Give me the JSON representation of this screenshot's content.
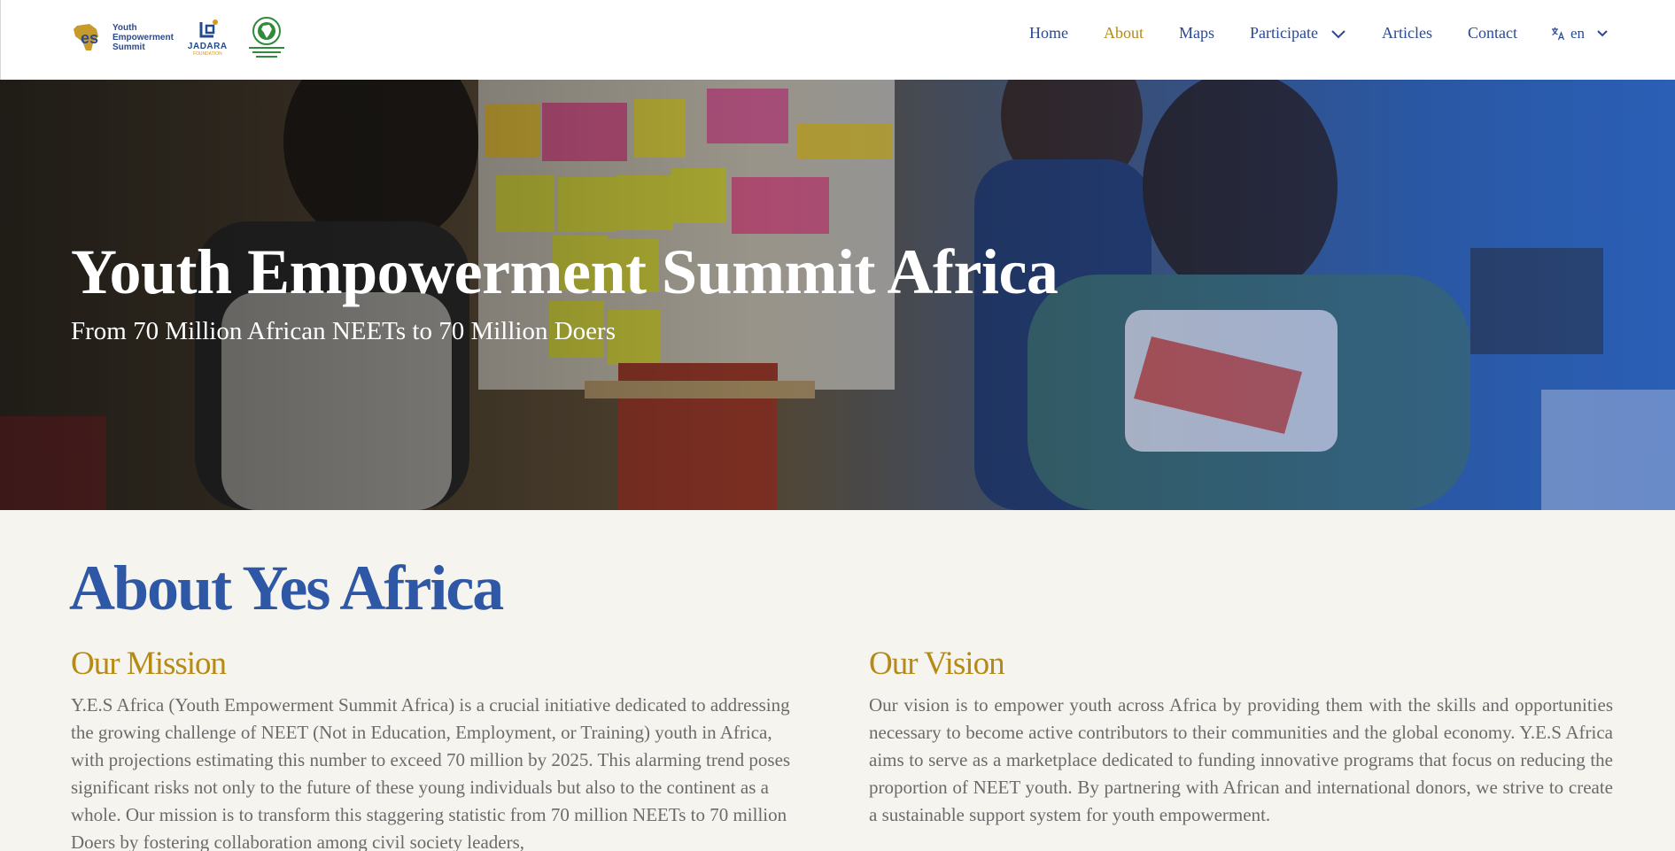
{
  "header": {
    "logos": {
      "yes": {
        "mark": "Yes",
        "line1": "Youth",
        "line2": "Empowerment",
        "line3": "Summit"
      },
      "jadara": {
        "name": "JADARA",
        "tagline": "FOUNDATION"
      },
      "au": {
        "icon": "african-union-emblem"
      }
    },
    "nav": {
      "home": "Home",
      "about": "About",
      "maps": "Maps",
      "participate": "Participate",
      "articles": "Articles",
      "contact": "Contact",
      "language": "en"
    },
    "active_item": "About",
    "colors": {
      "nav": "#2a4a8f",
      "active": "#b58a16"
    }
  },
  "hero": {
    "title": "Youth Empowerment Summit Africa",
    "subtitle": "From 70 Million African NEETs to 70 Million Doers"
  },
  "about": {
    "title": "About Yes Africa",
    "mission": {
      "heading": "Our Mission",
      "text": "Y.E.S Africa (Youth Empowerment Summit Africa) is a crucial initiative dedicated to addressing the growing challenge of NEET (Not in Education, Employment, or Training) youth in Africa, with projections estimating this number to exceed 70 million by 2025. This alarming trend poses significant risks not only to the future of these young individuals but also to the continent as a whole. Our mission is to transform this staggering statistic from 70 million NEETs to 70 million Doers by fostering collaboration among civil society leaders,"
    },
    "vision": {
      "heading": "Our Vision",
      "text": "Our vision is to empower youth across Africa by providing them with the skills and opportunities necessary to become active contributors to their communities and the global economy. Y.E.S Africa aims to serve as a marketplace dedicated to funding innovative programs that focus on reducing the proportion of NEET youth. By partnering with African and international donors, we strive to create a sustainable support system for youth empowerment."
    },
    "colors": {
      "title": "#2e57a6",
      "heading": "#b58a16",
      "body": "#6b6b6b"
    }
  }
}
